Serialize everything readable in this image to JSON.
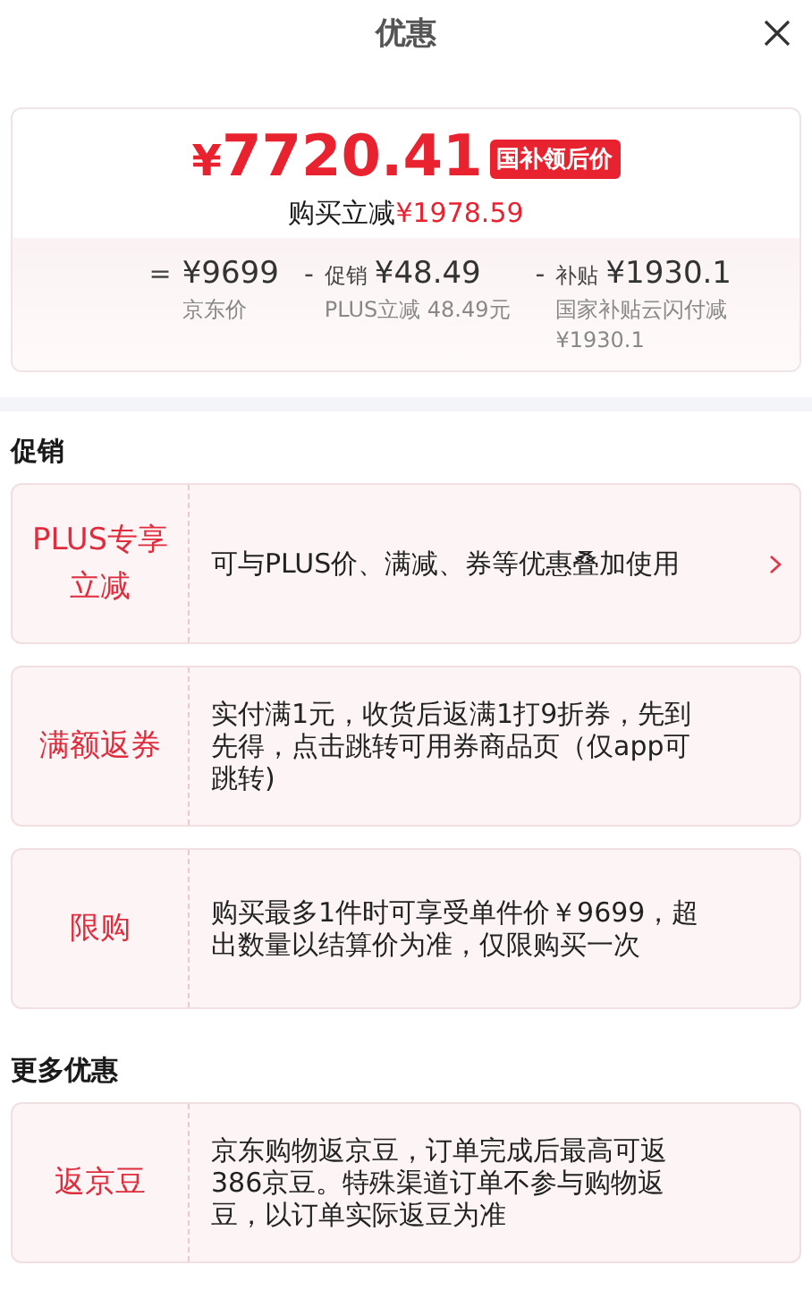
{
  "header": {
    "title": "优惠"
  },
  "summary": {
    "price": "¥7720.41",
    "price_tag": "国补领后价",
    "savings_label": "购买立减",
    "savings_amount": "¥1978.59",
    "breakdown": [
      {
        "op": "=",
        "amount": "¥9699",
        "caption": "京东价"
      },
      {
        "op": "-",
        "label": "促销",
        "amount": "¥48.49",
        "caption": "PLUS立减 48.49元"
      },
      {
        "op": "-",
        "label": "补贴",
        "amount": "¥1930.1",
        "caption": "国家补贴云闪付减¥1930.1"
      }
    ]
  },
  "sections": [
    {
      "title": "促销",
      "cards": [
        {
          "name": "PLUS专享立减",
          "description": "可与PLUS价、满减、券等优惠叠加使用",
          "link": true
        },
        {
          "name": "满额返券",
          "description": "实付满1元，收货后返满1打9折券，先到先得，点击跳转可用券商品页（仅app可跳转)",
          "link": false
        },
        {
          "name": "限购",
          "description": "购买最多1件时可享受单件价￥9699，超出数量以结算价为准，仅限购买一次",
          "link": false
        }
      ]
    },
    {
      "title": "更多优惠",
      "cards": [
        {
          "name": "返京豆",
          "description": "京东购物返京豆，订单完成后最高可返386京豆。特殊渠道订单不参与购物返豆，以订单实际返豆为准",
          "link": false
        }
      ]
    }
  ]
}
